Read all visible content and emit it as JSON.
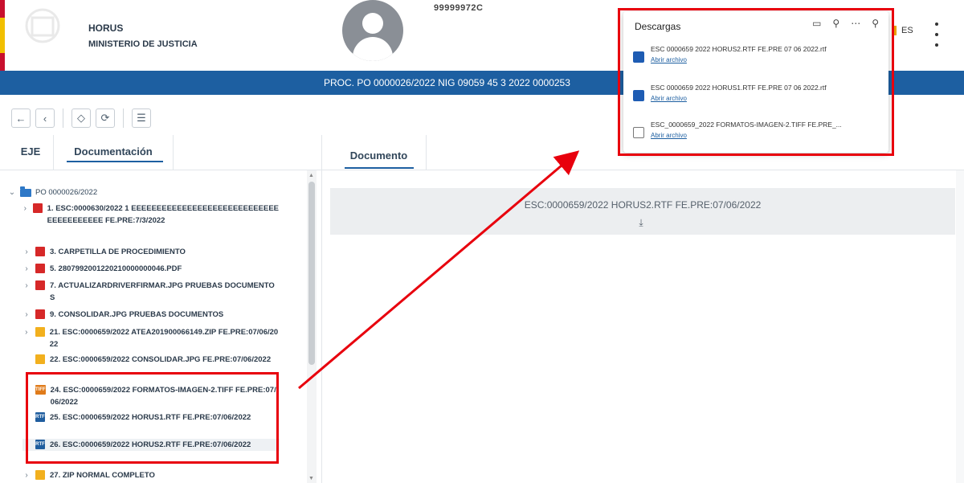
{
  "header": {
    "org_name": "HORUS",
    "org_sub": "MINISTERIO DE JUSTICIA",
    "user_id": "99999972C",
    "lang": "ES"
  },
  "proc_bar": {
    "text": "PROC. PO 0000026/2022 NIG 09059 45 3 2022 0000253"
  },
  "toolbar": {
    "icons": [
      "arrow-left-icon",
      "chevron-left-icon",
      "expand-collapse-icon",
      "refresh-icon",
      "panel-icon"
    ]
  },
  "left_tabs": {
    "eje": "EJE",
    "documentacion": "Documentación"
  },
  "tree": {
    "root": "PO 0000026/2022",
    "items": [
      {
        "type": "pdf",
        "label": "1. ESC:0000630/2022 1 EEEEEEEEEEEEEEEEEEEEEEEEEEEEEEEEEEEEEEEE FE.PRE:7/3/2022",
        "expand": true
      },
      {
        "type": "pdf",
        "label": "3. CARPETILLA DE PROCEDIMIENTO",
        "expand": true
      },
      {
        "type": "pdf",
        "label": "5. 2807992001220210000000046.PDF",
        "expand": true
      },
      {
        "type": "pdf",
        "label": "7. ACTUALIZARDRIVERFIRMAR.JPG PRUEBAS DOCUMENTOS",
        "expand": true
      },
      {
        "type": "pdf",
        "label": "9. CONSOLIDAR.JPG PRUEBAS DOCUMENTOS",
        "expand": true
      },
      {
        "type": "zip",
        "label": "21. ESC:0000659/2022 ATEA201900066149.ZIP FE.PRE:07/06/2022",
        "expand": true
      },
      {
        "type": "jpg",
        "label": "22. ESC:0000659/2022 CONSOLIDAR.JPG FE.PRE:07/06/2022",
        "expand": false
      },
      {
        "type": "tiff",
        "label": "24. ESC:0000659/2022 FORMATOS-IMAGEN-2.TIFF FE.PRE:07/06/2022",
        "expand": false
      },
      {
        "type": "rtf",
        "label": "25. ESC:0000659/2022 HORUS1.RTF FE.PRE:07/06/2022",
        "expand": false
      },
      {
        "type": "rtf",
        "label": "26. ESC:0000659/2022 HORUS2.RTF FE.PRE:07/06/2022",
        "expand": false
      },
      {
        "type": "zip",
        "label": "27. ZIP NORMAL COMPLETO",
        "expand": true
      }
    ]
  },
  "right_tabs": {
    "documento": "Documento"
  },
  "document": {
    "title": "ESC:0000659/2022 HORUS2.RTF FE.PRE:07/06/2022"
  },
  "downloads": {
    "title": "Descargas",
    "items": [
      {
        "icon": "word-icon",
        "name": "ESC 0000659 2022 HORUS2.RTF FE.PRE 07 06 2022.rtf",
        "action": "Abrir archivo"
      },
      {
        "icon": "word-icon",
        "name": "ESC 0000659 2022 HORUS1.RTF FE.PRE 07 06 2022.rtf",
        "action": "Abrir archivo"
      },
      {
        "icon": "image-icon",
        "name": "ESC_0000659_2022 FORMATOS-IMAGEN-2.TIFF FE.PRE_...",
        "action": "Abrir archivo"
      }
    ]
  },
  "colors": {
    "brand_blue": "#1d5fa1",
    "annotation_red": "#e8000d"
  }
}
